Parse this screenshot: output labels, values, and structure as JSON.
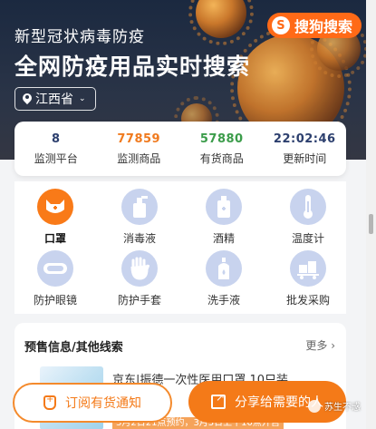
{
  "hero": {
    "subtitle": "新型冠状病毒防疫",
    "title": "全网防疫用品实时搜索",
    "region": "江西省"
  },
  "brand": {
    "mark": "S",
    "label": "搜狗搜索"
  },
  "stats": [
    {
      "value": "8",
      "label": "监测平台",
      "color": "#2c3f6e"
    },
    {
      "value": "77859",
      "label": "监测商品",
      "color": "#f07a1e"
    },
    {
      "value": "57880",
      "label": "有货商品",
      "color": "#3b9c4a"
    },
    {
      "value": "22:02:46",
      "label": "更新时间",
      "color": "#2c3f6e"
    }
  ],
  "categories": [
    {
      "label": "口罩",
      "icon": "mask-icon",
      "active": true
    },
    {
      "label": "消毒液",
      "icon": "disinfectant-icon",
      "active": false
    },
    {
      "label": "酒精",
      "icon": "alcohol-bottle-icon",
      "active": false
    },
    {
      "label": "温度计",
      "icon": "thermometer-icon",
      "active": false
    },
    {
      "label": "防护眼镜",
      "icon": "goggles-icon",
      "active": false
    },
    {
      "label": "防护手套",
      "icon": "glove-icon",
      "active": false
    },
    {
      "label": "洗手液",
      "icon": "handwash-icon",
      "active": false
    },
    {
      "label": "批发采购",
      "icon": "wholesale-icon",
      "active": false
    }
  ],
  "section": {
    "title": "预售信息/其他线索",
    "more": "更多",
    "item_title": "京东|振德一次性医用口罩 10只装",
    "item_note": "3月2日21点预约，3月3日上午10点开售"
  },
  "buttons": {
    "notify": "订阅有货通知",
    "share": "分享给需要的人"
  },
  "watermark": "苏生不惑",
  "colors": {
    "accent": "#f47a18",
    "hero_bg": "#1b2940",
    "icon_bg": "#c8d3ee"
  }
}
